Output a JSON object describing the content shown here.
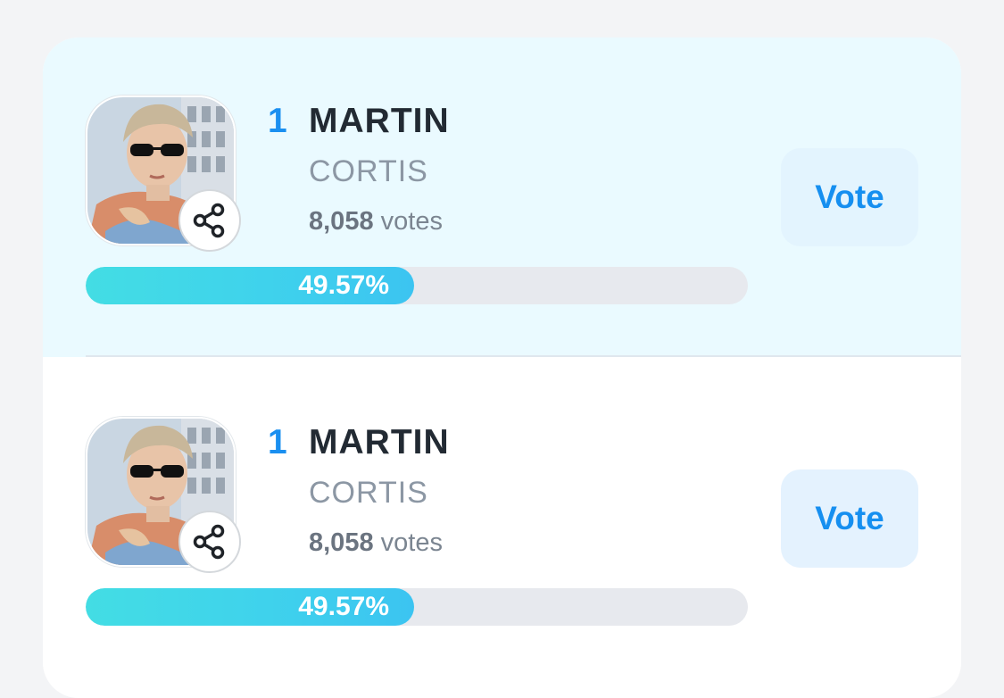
{
  "entries": [
    {
      "rank": "1",
      "name": "MARTIN",
      "group": "CORTIS",
      "votes_count": "8,058",
      "votes_label": "votes",
      "percent_label": "49.57%",
      "percent": 49.57,
      "vote_button": "Vote",
      "highlighted": true
    },
    {
      "rank": "1",
      "name": "MARTIN",
      "group": "CORTIS",
      "votes_count": "8,058",
      "votes_label": "votes",
      "percent_label": "49.57%",
      "percent": 49.57,
      "vote_button": "Vote",
      "highlighted": false
    }
  ],
  "icons": {
    "share": "share-icon"
  },
  "colors": {
    "rank": "#1a8ff0",
    "vote_text": "#168ff0",
    "progress_start": "#43dde4",
    "progress_end": "#3cc4f1",
    "highlight_bg": "#eafaff"
  }
}
